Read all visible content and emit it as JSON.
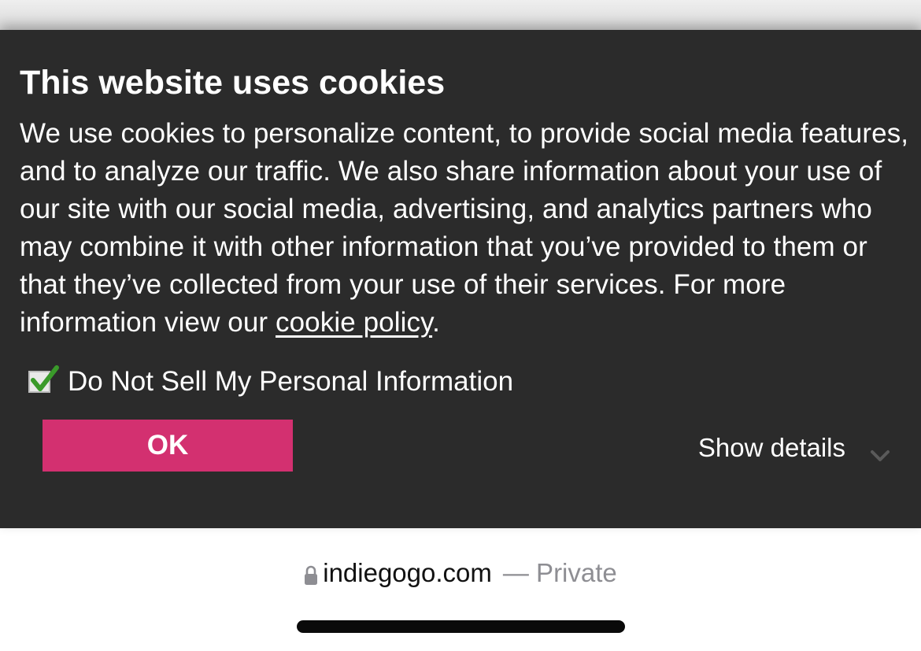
{
  "banner": {
    "title": "This website uses cookies",
    "text_before_link": "We use cookies to personalize content, to provide social media features, and to analyze our traffic. We also share information about your use of our site with our social media, advertising, and analytics partners who may combine it with other information that you’ve provided to them or that they’ve collected from your use of their services. For more information view our ",
    "link_text": "cookie policy",
    "text_after_link": ".",
    "checkbox_label": "Do Not Sell My Personal Information",
    "checkbox_checked": true,
    "ok_label": "OK",
    "show_details_label": "Show details",
    "background_color": "#2b2b2b",
    "accent_color": "#d33070"
  },
  "browser": {
    "domain": "indiegogo.com",
    "privacy_label": "— Private",
    "lock_icon": "lock-icon"
  }
}
